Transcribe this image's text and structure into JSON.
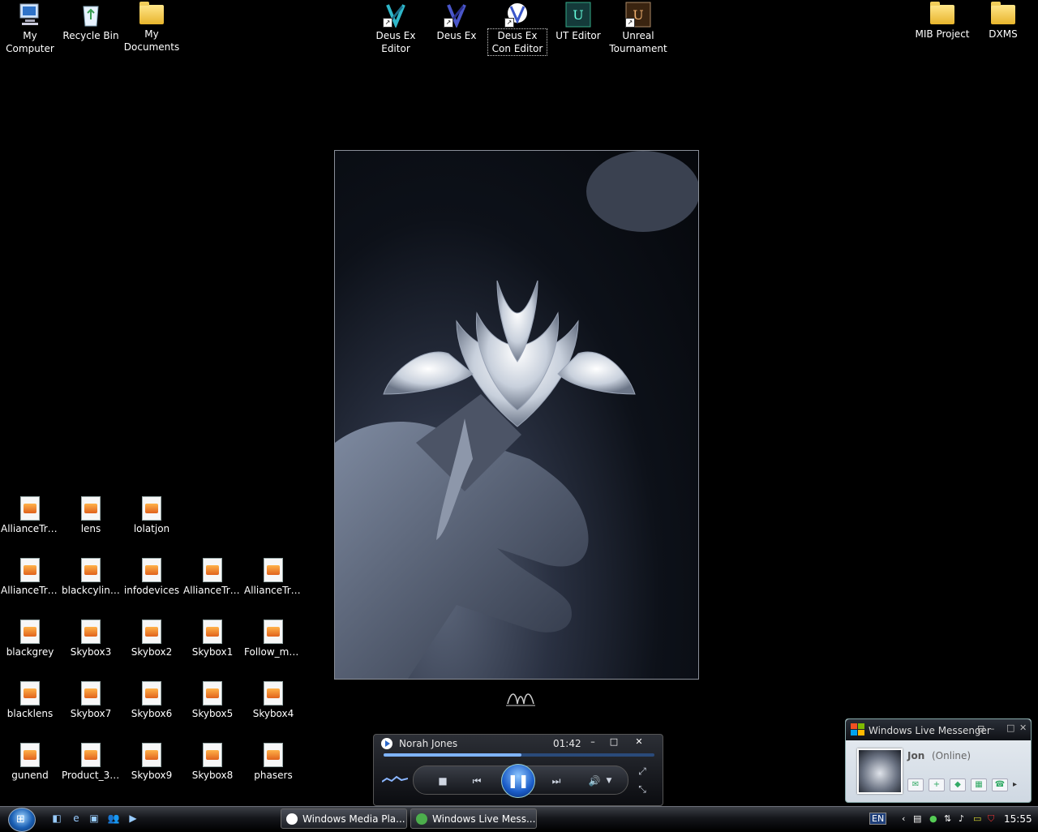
{
  "desktop_icons_top": [
    {
      "label": "My Computer",
      "icon": "computer-icon"
    },
    {
      "label": "Recycle Bin",
      "icon": "recycle-bin-icon"
    },
    {
      "label": "My Documents",
      "icon": "documents-folder-icon"
    },
    {
      "label": "Deus Ex Editor",
      "icon": "deus-ex-editor-icon"
    },
    {
      "label": "Deus Ex",
      "icon": "deus-ex-icon"
    },
    {
      "label": "Deus Ex Con Editor",
      "icon": "deus-ex-con-editor-icon"
    },
    {
      "label": "UT Editor",
      "icon": "ut-editor-icon"
    },
    {
      "label": "Unreal Tournament",
      "icon": "unreal-tournament-icon"
    },
    {
      "label": "MIB Project",
      "icon": "folder-icon"
    },
    {
      "label": "DXMS",
      "icon": "folder-icon"
    }
  ],
  "desktop_files": [
    "AllianceTri...",
    "lens",
    "lolatjon",
    "AllianceTri...",
    "blackcylinder",
    "infodevices",
    "AllianceTri...",
    "AllianceTri...",
    "blackgrey",
    "Skybox3",
    "Skybox2",
    "Skybox1",
    "Follow_me...",
    "blacklens",
    "Skybox7",
    "Skybox6",
    "Skybox5",
    "Skybox4",
    "gunend",
    "Product_3113",
    "Skybox9",
    "Skybox8",
    "phasers"
  ],
  "media_player": {
    "track": "Norah Jones",
    "elapsed": "01:42",
    "progress_fraction": 0.51,
    "buttons": {
      "minimize": "–",
      "restore": "□",
      "close": "✕"
    }
  },
  "messenger": {
    "title": "Windows Live Messenger",
    "name": "Jon",
    "status": "(Online)"
  },
  "taskbar": {
    "buttons": [
      "Windows Media Pla...",
      "Windows Live Mess..."
    ],
    "language": "EN",
    "clock": "15:55"
  },
  "colors": {
    "desktop_bg": "#000000",
    "accent": "#1a5fb4"
  }
}
